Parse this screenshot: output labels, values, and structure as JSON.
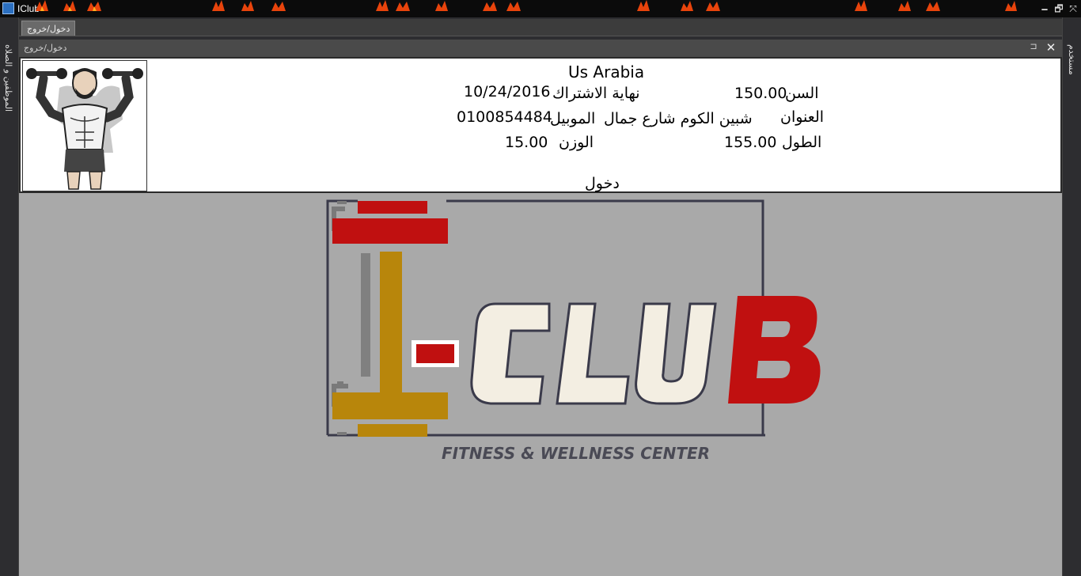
{
  "window": {
    "title": "IClub",
    "minimize_glyph": "🗕",
    "maximize_glyph": "🗗",
    "fullscreen_glyph": "⤧"
  },
  "tabs": [
    {
      "label": "دخول/خروج"
    }
  ],
  "left_rail": {
    "label": "الموظفين و الصلاه"
  },
  "right_rail": {
    "label": "مستخدم"
  },
  "panel": {
    "title": "دخول/خروج",
    "pin_glyph": "⊐",
    "close_glyph": "✕"
  },
  "member": {
    "name": "Us Arabia",
    "age_label": "السن",
    "age": "150.00",
    "subscription_end_label": "نهاية الاشتراك",
    "subscription_end": "10/24/2016",
    "address_label": "العنوان",
    "address": "شبين الكوم شارع جمال",
    "mobile_label": "الموبيل",
    "mobile": "0100854484",
    "height_label": "الطول",
    "height": "155.00",
    "weight_label": "الوزن",
    "weight": "15.00",
    "status": "دخول"
  },
  "logo": {
    "text": "CLUB",
    "subtitle": "FITNESS & WELLNESS CENTER",
    "icon": "iclub-logo"
  },
  "colors": {
    "accent_red": "#c01010",
    "gold": "#b8860b",
    "panel_bg": "#a9a9a9"
  }
}
